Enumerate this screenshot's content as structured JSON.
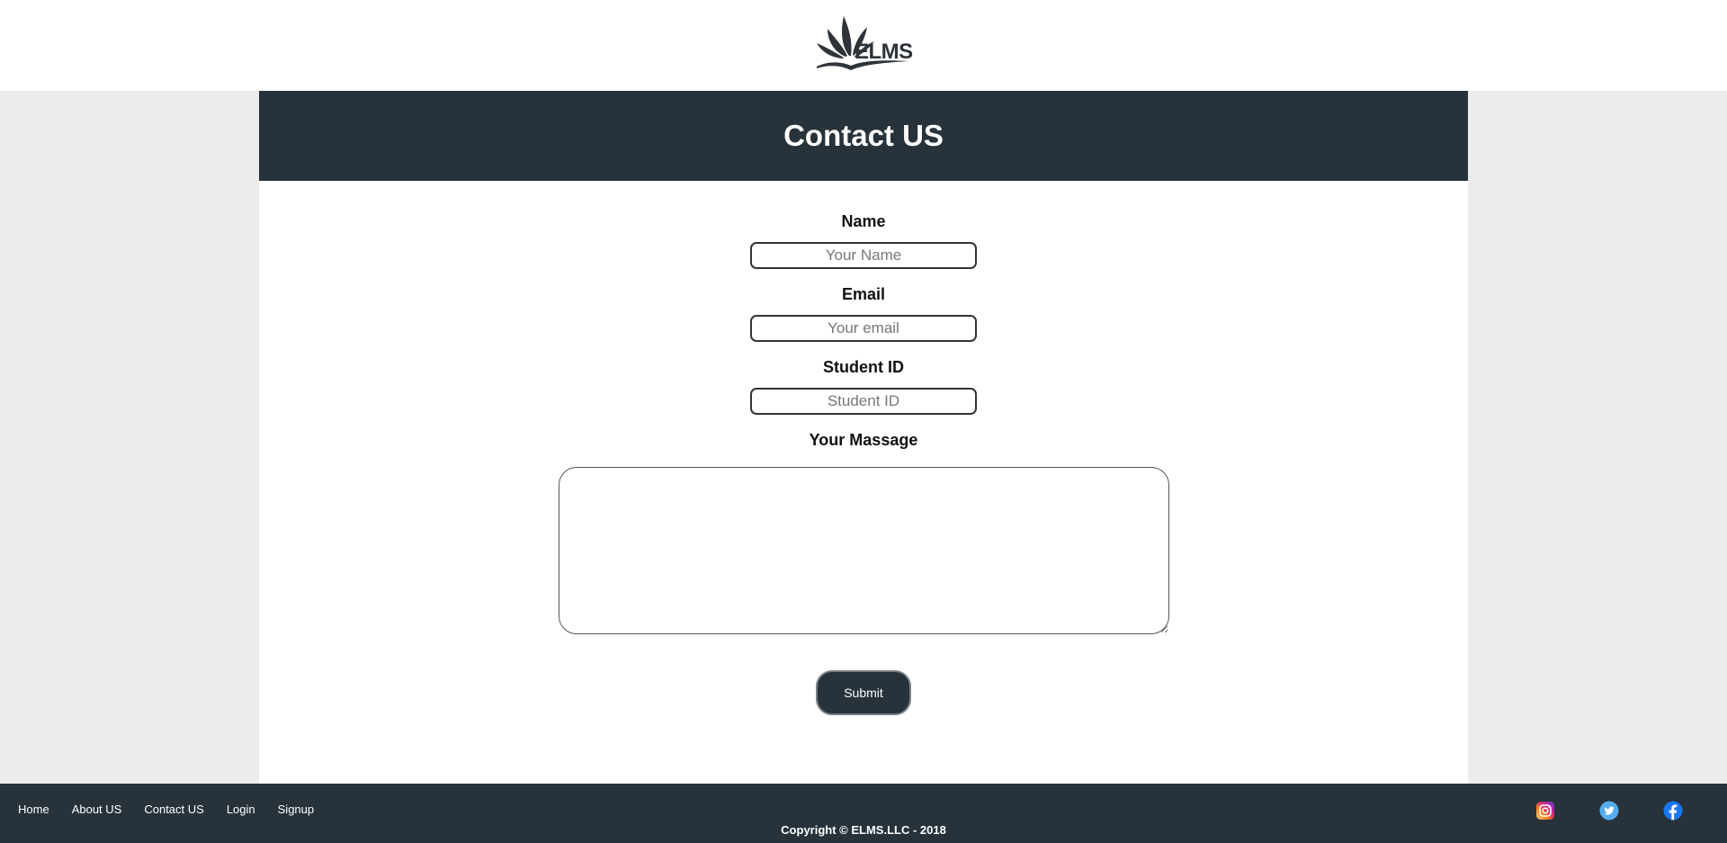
{
  "header": {
    "logo_text": "ELMS"
  },
  "page": {
    "title": "Contact US"
  },
  "form": {
    "name_label": "Name",
    "name_placeholder": "Your Name",
    "email_label": "Email",
    "email_placeholder": "Your email",
    "student_id_label": "Student ID",
    "student_id_placeholder": "Student ID",
    "message_label": "Your Massage",
    "submit_label": "Submit"
  },
  "footer": {
    "nav": [
      "Home",
      "About US",
      "Contact US",
      "Login",
      "Signup"
    ],
    "copyright": "Copyright © ELMS.LLC - 2018",
    "social_icons": [
      "instagram-icon",
      "twitter-icon",
      "facebook-icon"
    ]
  },
  "colors": {
    "dark": "#27323a",
    "background": "#ececec",
    "panel": "#ffffff"
  }
}
